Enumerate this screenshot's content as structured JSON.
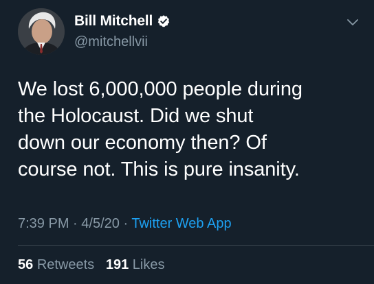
{
  "user": {
    "display_name": "Bill Mitchell",
    "handle": "@mitchellvii",
    "verified": true,
    "avatar_icon": "avatar-photo"
  },
  "tweet": {
    "lines": [
      "We lost 6,000,000 people during",
      "the Holocaust. Did we shut",
      "down our economy then? Of",
      "course not. This is pure insanity."
    ],
    "time": "7:39 PM",
    "separator": "·",
    "date": "4/5/20",
    "source": "Twitter Web App"
  },
  "stats": {
    "retweets_count": "56",
    "retweets_label": "Retweets",
    "likes_count": "191",
    "likes_label": "Likes"
  },
  "colors": {
    "background": "#15202b",
    "secondary_text": "#8899a6",
    "link": "#1da1f2",
    "divider": "#38444d"
  }
}
